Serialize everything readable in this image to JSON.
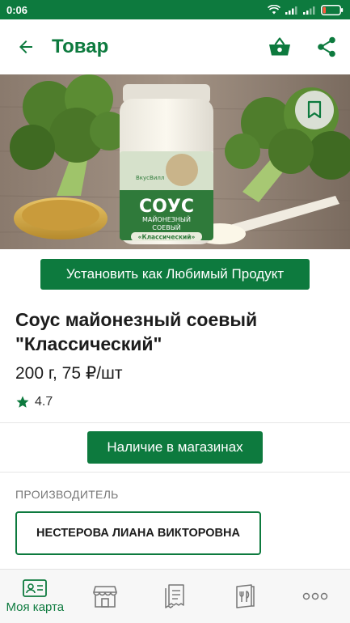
{
  "status_bar": {
    "time": "0:06",
    "icons": [
      "wifi-icon",
      "signal-icon",
      "signal-icon",
      "battery-icon"
    ]
  },
  "header": {
    "title": "Товар",
    "back_icon": "arrow-left-icon",
    "actions": [
      "basket-icon",
      "share-icon"
    ]
  },
  "hero": {
    "jar_brand": "ВкусВилл",
    "jar_title": "СОУС",
    "jar_line1": "МАЙОНЕЗНЫЙ",
    "jar_line2": "СОЕВЫЙ",
    "jar_line3": "«Классический»",
    "bookmark_icon": "bookmark-icon"
  },
  "product": {
    "favorite_button": "Установить как Любимый Продукт",
    "name_line1": "Соус майонезный соевый",
    "name_line2": "\"Классический\"",
    "price": "200 г, 75 ₽/шт",
    "rating": "4.7",
    "availability_button": "Наличие в магазинах"
  },
  "manufacturer": {
    "label": "ПРОИЗВОДИТЕЛЬ",
    "name": "НЕСТЕРОВА ЛИАНА ВИКТОРОВНА"
  },
  "bottom_nav": {
    "items": [
      {
        "label": "Моя карта",
        "icon": "card-icon",
        "active": true
      },
      {
        "label": "",
        "icon": "store-icon"
      },
      {
        "label": "",
        "icon": "receipts-icon"
      },
      {
        "label": "",
        "icon": "menu-book-icon"
      },
      {
        "label": "",
        "icon": "more-icon"
      }
    ]
  },
  "colors": {
    "brand_green": "#0d7a3e",
    "text": "#1c1c1c",
    "muted": "#777777"
  }
}
